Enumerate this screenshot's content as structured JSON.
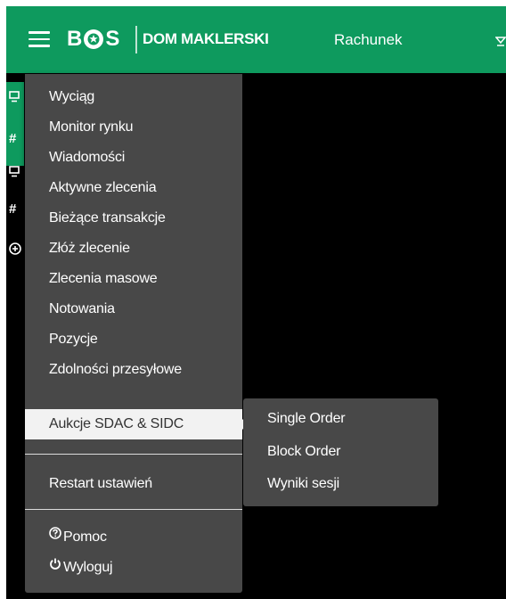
{
  "topbar": {
    "logo_left": "B",
    "logo_right": "S",
    "brand": "DOM MAKLERSKI",
    "account_label": "Rachunek"
  },
  "sidebar": {
    "icons": [
      "desktop-icon",
      "hash-icon",
      "desktop-icon",
      "hash-icon",
      "plus-circle-icon"
    ]
  },
  "menu": {
    "items": [
      {
        "label": "Wyciąg"
      },
      {
        "label": "Monitor rynku"
      },
      {
        "label": "Wiadomości"
      },
      {
        "label": "Aktywne zlecenia"
      },
      {
        "label": "Bieżące transakcje"
      },
      {
        "label": "Złóż zlecenie"
      },
      {
        "label": "Zlecenia masowe"
      },
      {
        "label": "Notowania"
      },
      {
        "label": "Pozycje"
      },
      {
        "label": "Zdolności przesyłowe"
      },
      {
        "label": "Aukcje SDAC & SIDC",
        "active": true
      }
    ],
    "restart_label": "Restart ustawień",
    "help_label": "Pomoc",
    "logout_label": "Wyloguj"
  },
  "submenu": {
    "items": [
      {
        "label": "Single Order"
      },
      {
        "label": "Block Order"
      },
      {
        "label": "Wyniki sesji"
      }
    ]
  },
  "colors": {
    "brand_green": "#0e9a5e",
    "menu_bg": "#484848",
    "active_bg": "#f2f2f2",
    "app_bg": "#000000"
  }
}
